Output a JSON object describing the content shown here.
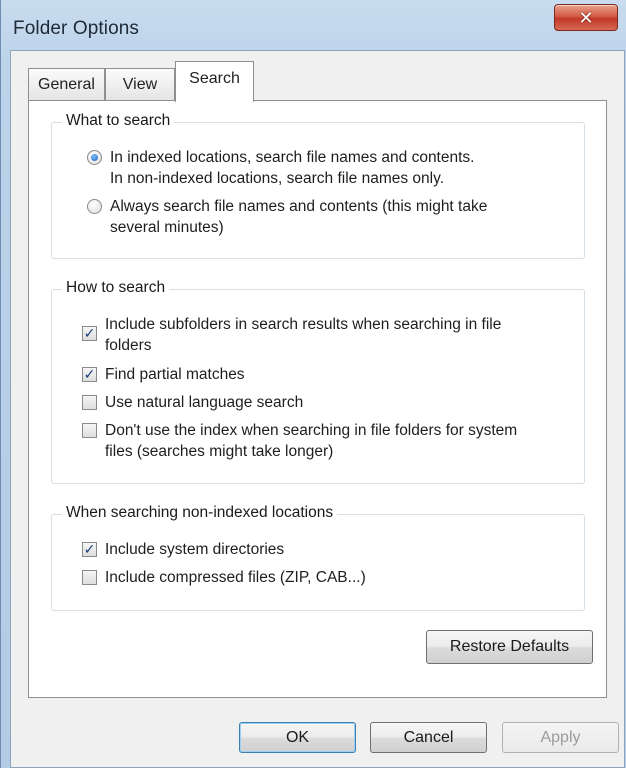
{
  "window": {
    "title": "Folder Options",
    "close_icon": "close-icon",
    "close_glyph": "✕"
  },
  "tabs": [
    {
      "label": "General",
      "active": false
    },
    {
      "label": "View",
      "active": false
    },
    {
      "label": "Search",
      "active": true
    }
  ],
  "what_to_search": {
    "label": "What to search",
    "options": [
      {
        "lines": [
          "In indexed locations, search file names and contents.",
          "In non-indexed locations, search file names only."
        ],
        "selected": true
      },
      {
        "lines": [
          "Always search file names and contents (this might take",
          "several minutes)"
        ],
        "selected": false
      }
    ]
  },
  "how_to_search": {
    "label": "How to search",
    "options": [
      {
        "lines": [
          "Include subfolders in search results when searching in file",
          "folders"
        ],
        "checked": true
      },
      {
        "lines": [
          "Find partial matches"
        ],
        "checked": true
      },
      {
        "lines": [
          "Use natural language search"
        ],
        "checked": false
      },
      {
        "lines": [
          "Don't use the index when searching in file folders for system",
          "files (searches might take longer)"
        ],
        "checked": false
      }
    ]
  },
  "non_indexed": {
    "label": "When searching non-indexed locations",
    "options": [
      {
        "lines": [
          "Include system directories"
        ],
        "checked": true
      },
      {
        "lines": [
          "Include compressed files (ZIP, CAB...)"
        ],
        "checked": false
      }
    ]
  },
  "buttons": {
    "restore_defaults": "Restore Defaults",
    "ok": "OK",
    "cancel": "Cancel",
    "apply": "Apply"
  },
  "check_glyph": "✓",
  "colors": {
    "title_bar": "#bcd3ea",
    "close_button": "#c2392a",
    "dialog_bg": "#f0f0f0",
    "tab_page_bg": "#ffffff"
  }
}
